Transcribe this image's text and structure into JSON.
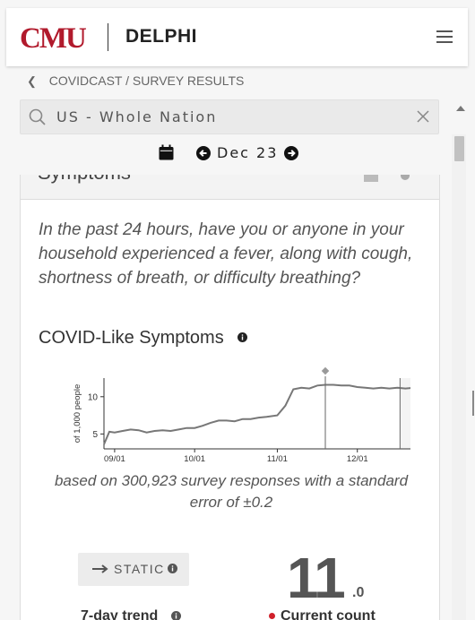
{
  "header": {
    "logo_left": "CMU",
    "logo_right": "DELPHI"
  },
  "breadcrumb": {
    "parent": "COVIDCAST",
    "separator": "/",
    "current": "SURVEY RESULTS"
  },
  "search": {
    "value": "US - Whole Nation"
  },
  "date_nav": {
    "date": "Dec 23"
  },
  "card": {
    "title": "Symptoms",
    "question": "In the past 24 hours, have you or anyone in your household experienced a fever, along with cough, shortness of breath, or difficulty breathing?",
    "chart_title": "COVID-Like Symptoms",
    "caption": "based on 300,923 survey responses with a standard error of ±0.2",
    "trend_button": "STATIC",
    "trend_label": "7-day trend",
    "big_number": "11",
    "big_decimal": ".0",
    "count_label": "Current count"
  },
  "chart_data": {
    "type": "line",
    "ylabel": "of 1,000 people",
    "ylim": [
      3.0,
      12.5
    ],
    "yticks": [
      "10",
      "5"
    ],
    "ytick_values": [
      10,
      5
    ],
    "xticks": [
      "09/01",
      "10/01",
      "11/01",
      "12/01"
    ],
    "xtick_dates": [
      "2020-09-01",
      "2020-10-01",
      "2020-11-01",
      "2020-12-01"
    ],
    "x_range": [
      "2020-08-28",
      "2020-12-31"
    ],
    "series": [
      {
        "x": [
          "2020-08-28",
          "2020-08-30",
          "2020-09-01",
          "2020-09-04",
          "2020-09-07",
          "2020-09-10",
          "2020-09-13",
          "2020-09-16",
          "2020-09-19",
          "2020-09-22",
          "2020-09-25",
          "2020-09-28",
          "2020-10-01",
          "2020-10-04",
          "2020-10-07",
          "2020-10-10",
          "2020-10-13",
          "2020-10-16",
          "2020-10-19",
          "2020-10-22",
          "2020-10-25",
          "2020-10-28",
          "2020-11-01",
          "2020-11-04",
          "2020-11-07",
          "2020-11-10",
          "2020-11-13",
          "2020-11-16",
          "2020-11-19",
          "2020-11-22",
          "2020-11-25",
          "2020-11-28",
          "2020-12-01",
          "2020-12-04",
          "2020-12-07",
          "2020-12-10",
          "2020-12-13",
          "2020-12-16",
          "2020-12-19",
          "2020-12-22",
          "2020-12-25",
          "2020-12-28",
          "2020-12-31"
        ],
        "y": [
          3.6,
          5.3,
          5.2,
          5.4,
          5.6,
          5.5,
          5.2,
          5.4,
          5.5,
          5.4,
          5.6,
          5.8,
          5.8,
          6.1,
          6.5,
          6.8,
          6.8,
          6.7,
          7.0,
          7.0,
          7.2,
          7.3,
          7.5,
          8.8,
          11.0,
          11.2,
          11.1,
          11.5,
          11.6,
          11.6,
          11.5,
          11.5,
          11.3,
          11.2,
          11.1,
          11.2,
          11.1,
          11.2,
          11.1,
          11.2,
          11.1,
          11.1,
          10.9
        ]
      }
    ],
    "highlight_start": "2020-12-17",
    "current_date": "2020-12-23",
    "current_value": 11.0,
    "annotation_date": "2020-11-19",
    "colors": {
      "line": "#777777",
      "current": "#d0202a",
      "annotation": "#999999"
    }
  }
}
